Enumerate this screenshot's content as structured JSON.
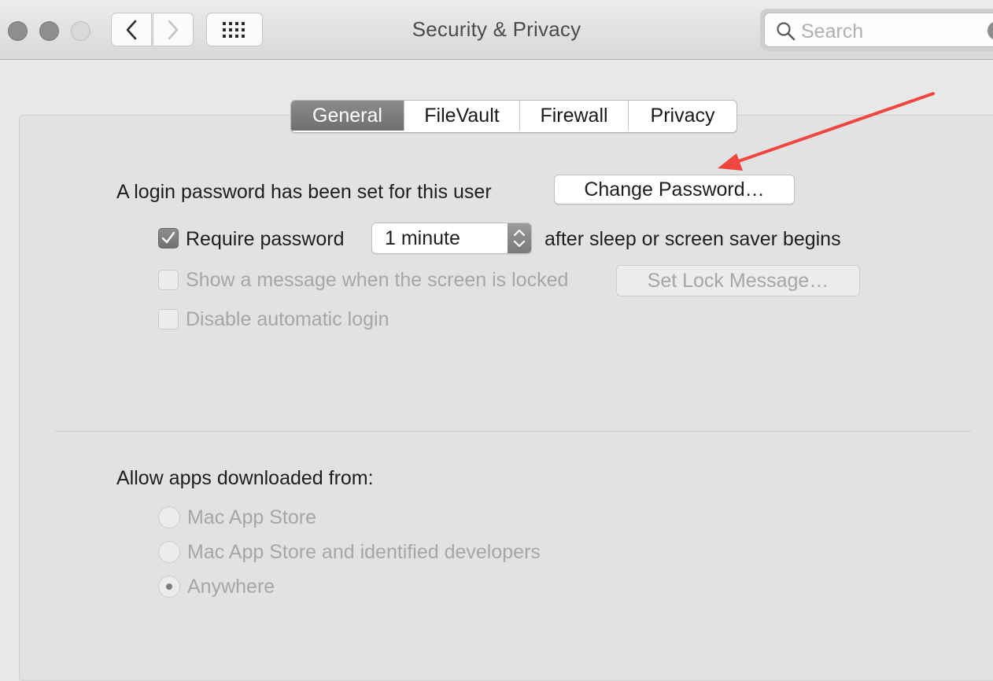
{
  "window": {
    "title": "Security & Privacy"
  },
  "search": {
    "placeholder": "Search"
  },
  "tabs": [
    {
      "label": "General",
      "active": true
    },
    {
      "label": "FileVault",
      "active": false
    },
    {
      "label": "Firewall",
      "active": false
    },
    {
      "label": "Privacy",
      "active": false
    }
  ],
  "general": {
    "login_text": "A login password has been set for this user",
    "change_password_label": "Change Password…",
    "require_password": {
      "label": "Require password",
      "checked": true
    },
    "delay_popup": {
      "selected": "1 minute"
    },
    "after_text": "after sleep or screen saver begins",
    "show_message": {
      "label": "Show a message when the screen is locked",
      "checked": false,
      "enabled": false
    },
    "set_lock_message_label": "Set Lock Message…",
    "disable_auto_login": {
      "label": "Disable automatic login",
      "checked": false,
      "enabled": false
    }
  },
  "gatekeeper": {
    "heading": "Allow apps downloaded from:",
    "options": [
      {
        "label": "Mac App Store",
        "selected": false
      },
      {
        "label": "Mac App Store and identified developers",
        "selected": false
      },
      {
        "label": "Anywhere",
        "selected": true
      }
    ]
  },
  "colors": {
    "annotation_arrow": "#f0463f",
    "active_tab": "#7d7d7d"
  }
}
